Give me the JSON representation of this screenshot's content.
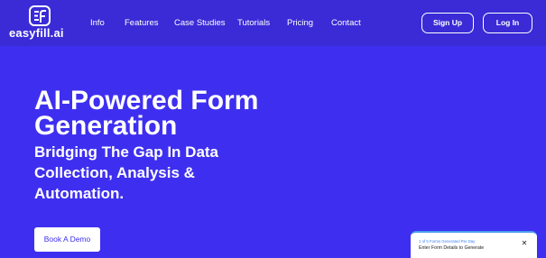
{
  "brand": {
    "name": "easyfill.ai",
    "icon": "easyfill-logo-icon"
  },
  "nav": {
    "links": [
      "Info",
      "Features",
      "Case Studies",
      "Tutorials",
      "Pricing",
      "Contact"
    ],
    "signup_label": "Sign Up",
    "login_label": "Log In"
  },
  "hero": {
    "title": "AI-Powered Form Generation",
    "subtitle": "Bridging The Gap In Data Collection, Analysis & Automation.",
    "cta_label": "Book A Demo"
  },
  "widget": {
    "counter": "1 of 5 Forms Generated Per Day",
    "prompt": "Enter Form Details to Generate",
    "close_icon": "close-icon"
  },
  "colors": {
    "background": "#3e2ff0",
    "navbar": "#3a2bd6",
    "text": "#ffffff",
    "widget_accent": "#3b82f6"
  }
}
